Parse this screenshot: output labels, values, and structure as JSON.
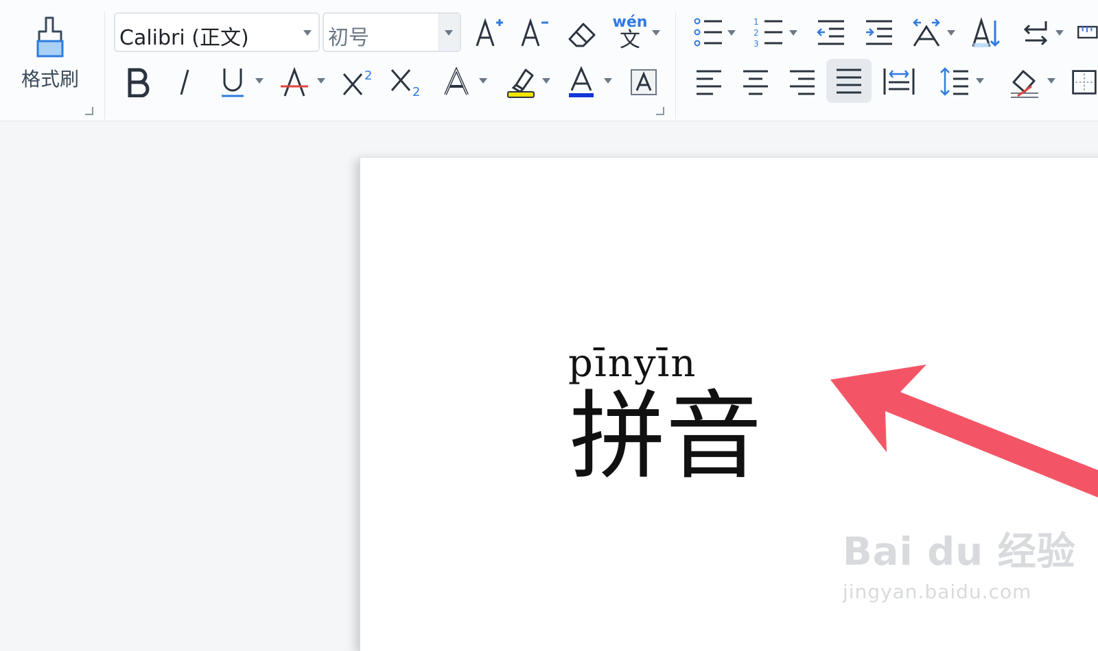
{
  "ribbon": {
    "format_painter_label": "格式刷",
    "font_name": "Calibri (正文)",
    "font_size_placeholder": "初号",
    "phonetic_guide_icon_text": "wén",
    "phonetic_guide_base": "文",
    "superscript_mark": "2",
    "subscript_mark": "2",
    "highlight_color": "#f5e400",
    "font_color": "#1236d8",
    "accent_color": "#2f7be0"
  },
  "document": {
    "pinyin": "pīnyīn",
    "hanzi": "拼音"
  },
  "annotation": {
    "arrow_color": "#f45566"
  },
  "watermark": {
    "brand": "Bai  du 经验",
    "url": "jingyan.baidu.com"
  }
}
